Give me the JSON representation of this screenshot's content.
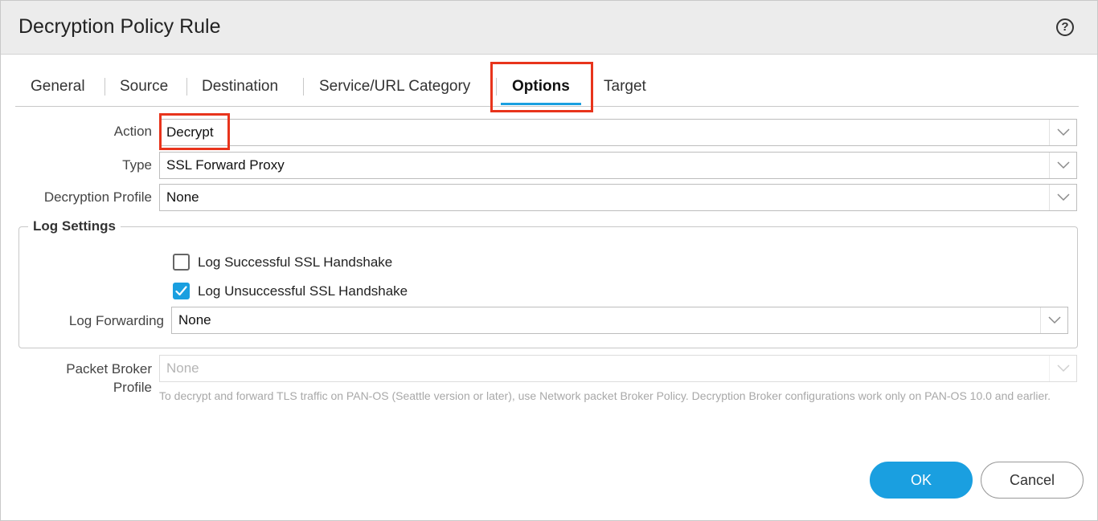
{
  "dialog": {
    "title": "Decryption Policy Rule",
    "help_icon": "question-circle-icon"
  },
  "tabs": [
    {
      "label": "General",
      "active": false
    },
    {
      "label": "Source",
      "active": false
    },
    {
      "label": "Destination",
      "active": false
    },
    {
      "label": "Service/URL Category",
      "active": false
    },
    {
      "label": "Options",
      "active": true
    },
    {
      "label": "Target",
      "active": false
    }
  ],
  "form": {
    "action": {
      "label": "Action",
      "value": "Decrypt"
    },
    "type": {
      "label": "Type",
      "value": "SSL Forward Proxy"
    },
    "decryption_profile": {
      "label": "Decryption Profile",
      "value": "None"
    }
  },
  "log_settings": {
    "legend": "Log Settings",
    "log_successful": {
      "label": "Log Successful SSL Handshake",
      "checked": false
    },
    "log_unsuccessful": {
      "label": "Log Unsuccessful SSL Handshake",
      "checked": true
    },
    "log_forwarding": {
      "label": "Log Forwarding",
      "value": "None"
    }
  },
  "packet_broker": {
    "label_line1": "Packet Broker",
    "label_line2": "Profile",
    "value": "None",
    "disabled": true,
    "help_text": "To decrypt and forward TLS traffic on PAN-OS (Seattle version or later), use Network packet Broker Policy. Decryption Broker configurations work only on PAN-OS 10.0 and earlier."
  },
  "buttons": {
    "ok": "OK",
    "cancel": "Cancel"
  },
  "colors": {
    "accent": "#1a9fe0",
    "highlight": "#e8341c"
  }
}
